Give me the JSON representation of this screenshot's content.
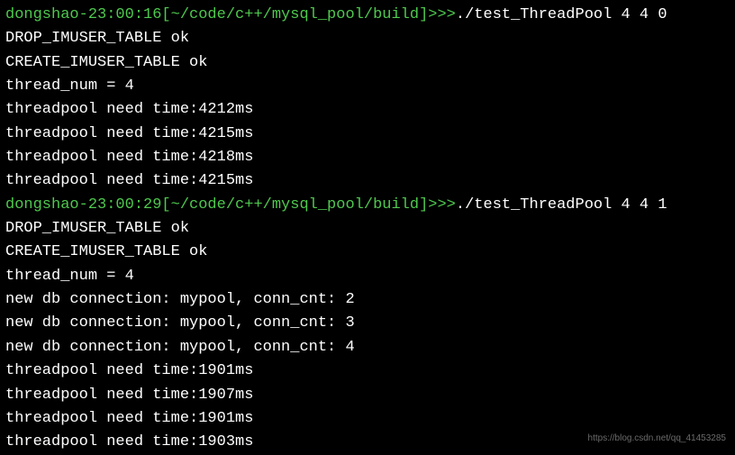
{
  "sessions": [
    {
      "prompt": {
        "user": "dongshao",
        "time": "23:00:16",
        "path": "~/code/c++/mysql_pool/build",
        "marker": ">>>"
      },
      "command": "./test_ThreadPool 4 4 0",
      "output": [
        "DROP_IMUSER_TABLE ok",
        "CREATE_IMUSER_TABLE ok",
        "thread_num = 4",
        "threadpool need time:4212ms",
        "threadpool need time:4215ms",
        "threadpool need time:4218ms",
        "threadpool need time:4215ms"
      ]
    },
    {
      "prompt": {
        "user": "dongshao",
        "time": "23:00:29",
        "path": "~/code/c++/mysql_pool/build",
        "marker": ">>>"
      },
      "command": "./test_ThreadPool 4 4 1",
      "output": [
        "DROP_IMUSER_TABLE ok",
        "CREATE_IMUSER_TABLE ok",
        "thread_num = 4",
        "new db connection: mypool, conn_cnt: 2",
        "new db connection: mypool, conn_cnt: 3",
        "new db connection: mypool, conn_cnt: 4",
        "threadpool need time:1901ms",
        "threadpool need time:1907ms",
        "threadpool need time:1901ms",
        "threadpool need time:1903ms"
      ]
    }
  ],
  "watermark": "https://blog.csdn.net/qq_41453285"
}
